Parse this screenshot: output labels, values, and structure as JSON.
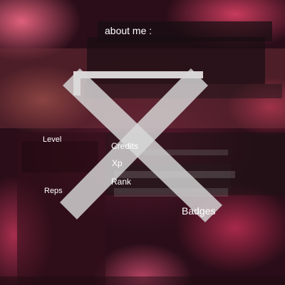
{
  "about": {
    "label": "about me :"
  },
  "stats": {
    "level_label": "Level",
    "reps_label": "Reps",
    "credits_label": "Credits",
    "xp_label": "Xp",
    "rank_label": "Rank"
  },
  "badges": {
    "label": "Badges"
  },
  "icons": {
    "avatar_placeholder": "x-placeholder-icon"
  },
  "colors": {
    "accent": "#e85a7a",
    "panel_dark": "#1e1014",
    "text": "#ffffff"
  }
}
